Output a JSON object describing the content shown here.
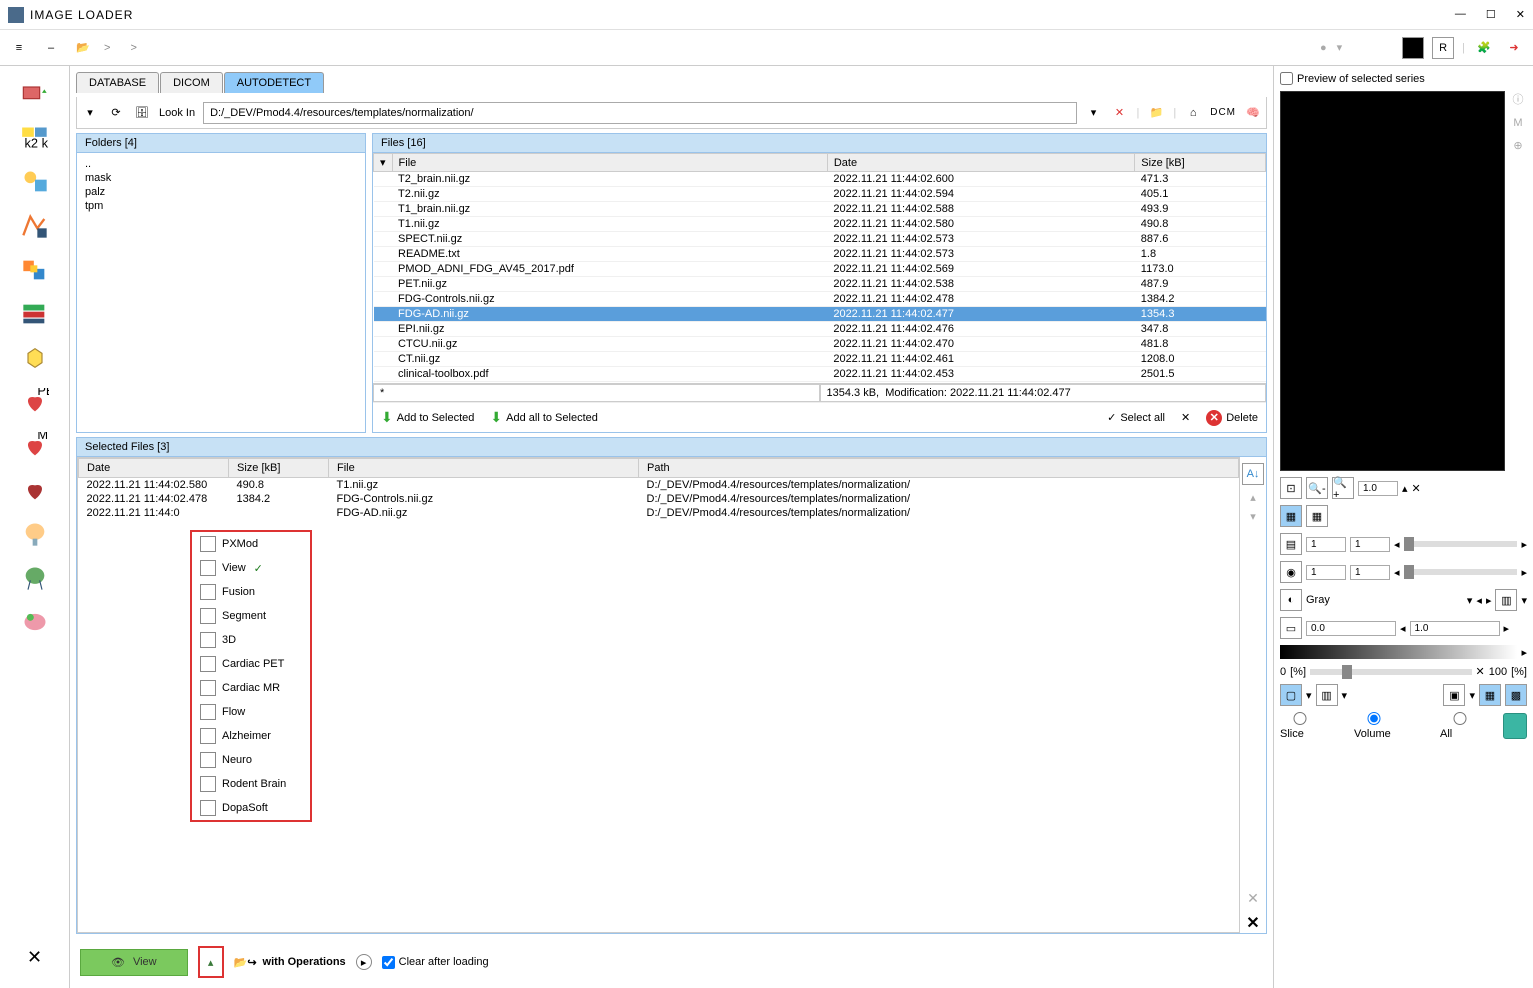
{
  "window": {
    "title": "IMAGE LOADER"
  },
  "toolbar": {
    "crumb1": ">",
    "crumb2": ">",
    "r_label": "R"
  },
  "tabs": [
    {
      "label": "DATABASE",
      "active": false
    },
    {
      "label": "DICOM",
      "active": false
    },
    {
      "label": "AUTODETECT",
      "active": true
    }
  ],
  "path": {
    "label": "Look In",
    "value": "D:/_DEV/Pmod4.4/resources/templates/normalization/",
    "dcm": "DCM"
  },
  "folders": {
    "header": "Folders [4]",
    "items": [
      "..",
      "mask",
      "palz",
      "tpm"
    ]
  },
  "files": {
    "header": "Files [16]",
    "cols": [
      "File",
      "Date",
      "Size [kB]"
    ],
    "rows": [
      {
        "file": "T2_brain.nii.gz",
        "date": "2022.11.21 11:44:02.600",
        "size": "471.3"
      },
      {
        "file": "T2.nii.gz",
        "date": "2022.11.21 11:44:02.594",
        "size": "405.1"
      },
      {
        "file": "T1_brain.nii.gz",
        "date": "2022.11.21 11:44:02.588",
        "size": "493.9"
      },
      {
        "file": "T1.nii.gz",
        "date": "2022.11.21 11:44:02.580",
        "size": "490.8"
      },
      {
        "file": "SPECT.nii.gz",
        "date": "2022.11.21 11:44:02.573",
        "size": "887.6"
      },
      {
        "file": "README.txt",
        "date": "2022.11.21 11:44:02.573",
        "size": "1.8"
      },
      {
        "file": "PMOD_ADNI_FDG_AV45_2017.pdf",
        "date": "2022.11.21 11:44:02.569",
        "size": "1173.0"
      },
      {
        "file": "PET.nii.gz",
        "date": "2022.11.21 11:44:02.538",
        "size": "487.9"
      },
      {
        "file": "FDG-Controls.nii.gz",
        "date": "2022.11.21 11:44:02.478",
        "size": "1384.2"
      },
      {
        "file": "FDG-AD.nii.gz",
        "date": "2022.11.21 11:44:02.477",
        "size": "1354.3",
        "sel": true
      },
      {
        "file": "EPI.nii.gz",
        "date": "2022.11.21 11:44:02.476",
        "size": "347.8"
      },
      {
        "file": "CTCU.nii.gz",
        "date": "2022.11.21 11:44:02.470",
        "size": "481.8"
      },
      {
        "file": "CT.nii.gz",
        "date": "2022.11.21 11:44:02.461",
        "size": "1208.0"
      },
      {
        "file": "clinical-toolbox.pdf",
        "date": "2022.11.21 11:44:02.453",
        "size": "2501.5"
      }
    ],
    "filter": "*",
    "status": "1354.3 kB,  Modification: 2022.11.21 11:44:02.477",
    "add_sel": "Add to Selected",
    "add_all": "Add all to Selected",
    "select_all": "Select all",
    "delete": "Delete"
  },
  "selected": {
    "header": "Selected Files [3]",
    "cols": [
      "Date",
      "Size [kB]",
      "File",
      "Path"
    ],
    "rows": [
      {
        "date": "2022.11.21 11:44:02.580",
        "size": "490.8",
        "file": "T1.nii.gz",
        "path": "D:/_DEV/Pmod4.4/resources/templates/normalization/"
      },
      {
        "date": "2022.11.21 11:44:02.478",
        "size": "1384.2",
        "file": "FDG-Controls.nii.gz",
        "path": "D:/_DEV/Pmod4.4/resources/templates/normalization/"
      },
      {
        "date": "2022.11.21 11:44:0",
        "size": "",
        "file": "FDG-AD.nii.gz",
        "path": "D:/_DEV/Pmod4.4/resources/templates/normalization/"
      }
    ]
  },
  "context_menu": {
    "items": [
      {
        "label": "PXMod"
      },
      {
        "label": "View",
        "checked": true
      },
      {
        "label": "Fusion"
      },
      {
        "label": "Segment"
      },
      {
        "label": "3D"
      },
      {
        "label": "Cardiac PET"
      },
      {
        "label": "Cardiac MR"
      },
      {
        "label": "Flow"
      },
      {
        "label": "Alzheimer"
      },
      {
        "label": "Neuro"
      },
      {
        "label": "Rodent Brain"
      },
      {
        "label": "DopaSoft"
      }
    ]
  },
  "bottom": {
    "view": "View",
    "with_ops": "with Operations",
    "clear": "Clear after loading"
  },
  "preview": {
    "checkbox": "Preview of selected series",
    "zoom": "1.0",
    "field1": "1",
    "field2": "1",
    "field3": "1",
    "field4": "1",
    "gray": "Gray",
    "lo": "0.0",
    "hi": "1.0",
    "pct0": "0",
    "pct100": "100",
    "pct_unit": "[%]",
    "slice": "Slice",
    "volume": "Volume",
    "all": "All"
  }
}
